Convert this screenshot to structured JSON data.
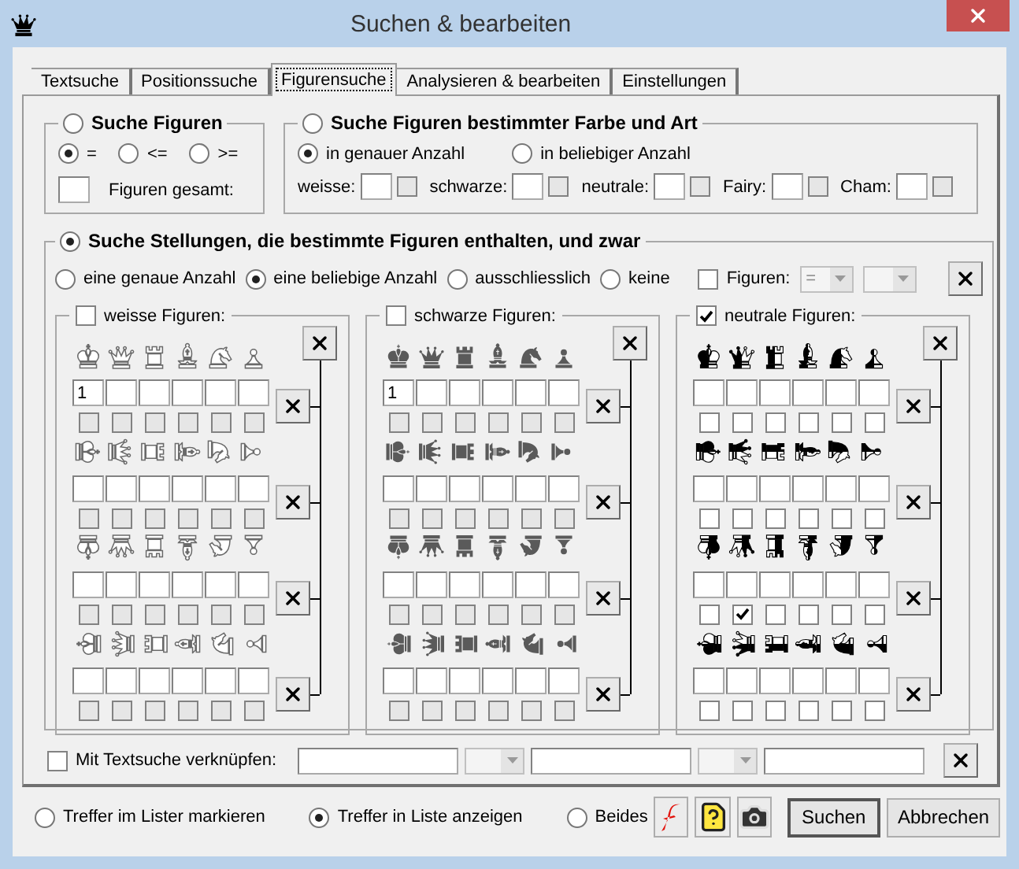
{
  "window": {
    "title": "Suchen & bearbeiten"
  },
  "tabs": [
    {
      "label": "Textsuche",
      "selected": false
    },
    {
      "label": "Positionssuche",
      "selected": false
    },
    {
      "label": "Figurensuche",
      "selected": true
    },
    {
      "label": "Analysieren & bearbeiten",
      "selected": false
    },
    {
      "label": "Einstellungen",
      "selected": false
    }
  ],
  "figure_count": {
    "label": "Suche Figuren",
    "selected": false,
    "operators": [
      {
        "label": "=",
        "selected": true
      },
      {
        "label": "<=",
        "selected": false
      },
      {
        "label": ">=",
        "selected": false
      }
    ],
    "total_label": "Figuren gesamt:"
  },
  "color_type": {
    "label": "Suche Figuren bestimmter Farbe und Art",
    "selected": false,
    "modes": [
      {
        "label": "in genauer Anzahl",
        "selected": true
      },
      {
        "label": "in beliebiger Anzahl",
        "selected": false
      }
    ],
    "fields": [
      {
        "label": "weisse:",
        "checked": false
      },
      {
        "label": "schwarze:",
        "checked": false
      },
      {
        "label": "neutrale:",
        "checked": false
      },
      {
        "label": "Fairy:",
        "checked": false
      },
      {
        "label": "Cham:",
        "checked": false
      }
    ]
  },
  "positions": {
    "label": "Suche Stellungen, die bestimmte Figuren enthalten, und zwar",
    "selected": true,
    "modes": [
      {
        "label": "eine genaue Anzahl",
        "selected": false
      },
      {
        "label": "eine beliebige Anzahl",
        "selected": true
      },
      {
        "label": "ausschliesslich",
        "selected": false
      },
      {
        "label": "keine",
        "selected": false
      }
    ],
    "figures_filter": {
      "label": "Figuren:",
      "checked": false,
      "operator": "="
    },
    "panels": [
      {
        "label": "weisse Figuren:",
        "checked": false,
        "kind": "white",
        "rows": [
          {
            "cells": [
              {
                "value": "1",
                "checked": false
              },
              {
                "checked": false
              },
              {
                "checked": false
              },
              {
                "checked": false
              },
              {
                "checked": false
              },
              {
                "checked": false
              }
            ]
          },
          {
            "cells": [
              {
                "checked": false
              },
              {
                "checked": false
              },
              {
                "checked": false
              },
              {
                "checked": false
              },
              {
                "checked": false
              },
              {
                "checked": false
              }
            ]
          },
          {
            "cells": [
              {
                "checked": false
              },
              {
                "checked": false
              },
              {
                "checked": false
              },
              {
                "checked": false
              },
              {
                "checked": false
              },
              {
                "checked": false
              }
            ]
          },
          {
            "cells": [
              {
                "checked": false
              },
              {
                "checked": false
              },
              {
                "checked": false
              },
              {
                "checked": false
              },
              {
                "checked": false
              },
              {
                "checked": false
              }
            ]
          }
        ]
      },
      {
        "label": "schwarze Figuren:",
        "checked": false,
        "kind": "black",
        "rows": [
          {
            "cells": [
              {
                "value": "1",
                "checked": false
              },
              {
                "checked": false
              },
              {
                "checked": false
              },
              {
                "checked": false
              },
              {
                "checked": false
              },
              {
                "checked": false
              }
            ]
          },
          {
            "cells": [
              {
                "checked": false
              },
              {
                "checked": false
              },
              {
                "checked": false
              },
              {
                "checked": false
              },
              {
                "checked": false
              },
              {
                "checked": false
              }
            ]
          },
          {
            "cells": [
              {
                "checked": false
              },
              {
                "checked": false
              },
              {
                "checked": false
              },
              {
                "checked": false
              },
              {
                "checked": false
              },
              {
                "checked": false
              }
            ]
          },
          {
            "cells": [
              {
                "checked": false
              },
              {
                "checked": false
              },
              {
                "checked": false
              },
              {
                "checked": false
              },
              {
                "checked": false
              },
              {
                "checked": false
              }
            ]
          }
        ]
      },
      {
        "label": "neutrale Figuren:",
        "checked": true,
        "kind": "neutral",
        "rows": [
          {
            "cells": [
              {
                "checked": false
              },
              {
                "checked": false
              },
              {
                "checked": false
              },
              {
                "checked": false
              },
              {
                "checked": false
              },
              {
                "checked": false
              }
            ]
          },
          {
            "cells": [
              {
                "checked": false
              },
              {
                "checked": false
              },
              {
                "checked": false
              },
              {
                "checked": false
              },
              {
                "checked": false
              },
              {
                "checked": false
              }
            ]
          },
          {
            "cells": [
              {
                "checked": false
              },
              {
                "checked": true
              },
              {
                "checked": false
              },
              {
                "checked": false
              },
              {
                "checked": false
              },
              {
                "checked": false
              }
            ]
          },
          {
            "cells": [
              {
                "checked": false
              },
              {
                "checked": false
              },
              {
                "checked": false
              },
              {
                "checked": false
              },
              {
                "checked": false
              },
              {
                "checked": false
              }
            ]
          }
        ]
      }
    ]
  },
  "text_link": {
    "label": "Mit Textsuche verknüpfen:",
    "checked": false
  },
  "result_options": [
    {
      "label": "Treffer im Lister markieren",
      "selected": false
    },
    {
      "label": "Treffer in Liste anzeigen",
      "selected": true
    },
    {
      "label": "Beides",
      "selected": false
    }
  ],
  "buttons": [
    {
      "label": "Suchen",
      "default": true
    },
    {
      "label": "Abbrechen",
      "default": false
    }
  ]
}
